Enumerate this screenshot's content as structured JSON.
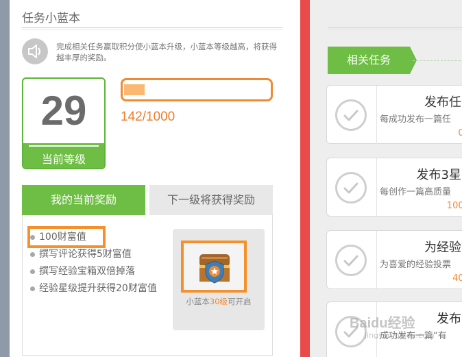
{
  "panel": {
    "title": "任务小蓝本",
    "description": "完成相关任务赢取积分使小蓝本升级，小蓝本等级越高，将获得越丰厚的奖励。"
  },
  "level": {
    "value": "29",
    "label": "当前等级"
  },
  "progress": {
    "text": "142/1000",
    "current": 142,
    "max": 1000,
    "fraction": 0.142
  },
  "tabs": [
    {
      "label": "我的当前奖励",
      "active": true
    },
    {
      "label": "下一级将获得奖励",
      "active": false
    }
  ],
  "rewards": [
    "100财富值",
    "撰写评论获得5财富值",
    "撰写经验宝箱双倍掉落",
    "经验星级提升获得20财富值"
  ],
  "chest": {
    "caption_prefix": "小蓝本",
    "caption_level": "30级",
    "caption_suffix": "可开启"
  },
  "related": {
    "section_label": "相关任务",
    "tasks": [
      {
        "title": "发布任",
        "desc": "每成功发布一篇任",
        "progress": "0/"
      },
      {
        "title": "发布3星",
        "desc": "每创作一篇高质量",
        "progress": "100/"
      },
      {
        "title": "为经验",
        "desc": "为喜爱的经验投票",
        "progress": "40/"
      },
      {
        "title": "发布",
        "desc": "成功发布一篇“有",
        "progress": "0/"
      }
    ]
  },
  "watermark": {
    "brand": "Baidu经验",
    "url": "jingyan.baidu.com"
  },
  "colors": {
    "green": "#6ebd44",
    "orange": "#f08a34",
    "red": "#e94a4a"
  }
}
